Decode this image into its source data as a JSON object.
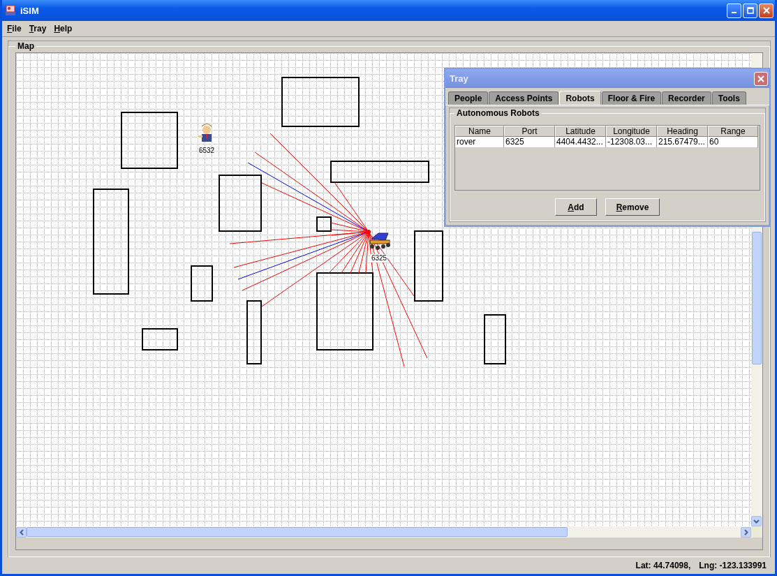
{
  "window": {
    "title": "iSIM"
  },
  "menu": [
    {
      "label": "File"
    },
    {
      "label": "Tray"
    },
    {
      "label": "Help"
    }
  ],
  "map": {
    "title": "Map",
    "markers": [
      {
        "kind": "person",
        "label": "6532"
      },
      {
        "kind": "robot",
        "label": "6325"
      }
    ]
  },
  "tray": {
    "title": "Tray",
    "tabs": [
      {
        "label": "People",
        "selected": false
      },
      {
        "label": "Access Points",
        "selected": false
      },
      {
        "label": "Robots",
        "selected": true
      },
      {
        "label": "Floor & Fire",
        "selected": false
      },
      {
        "label": "Recorder",
        "selected": false
      },
      {
        "label": "Tools",
        "selected": false
      }
    ],
    "group_title": "Autonomous Robots",
    "table": {
      "columns": [
        "Name",
        "Port",
        "Latitude",
        "Longitude",
        "Heading",
        "Range"
      ],
      "rows": [
        [
          "rover",
          "6325",
          "4404.4432...",
          "-12308.03...",
          "215.67479...",
          "60"
        ]
      ]
    },
    "buttons": [
      "Add",
      "Remove"
    ]
  },
  "status_bar": {
    "lat": "Lat: 44.74098,",
    "lng": "Lng: -123.133991"
  }
}
